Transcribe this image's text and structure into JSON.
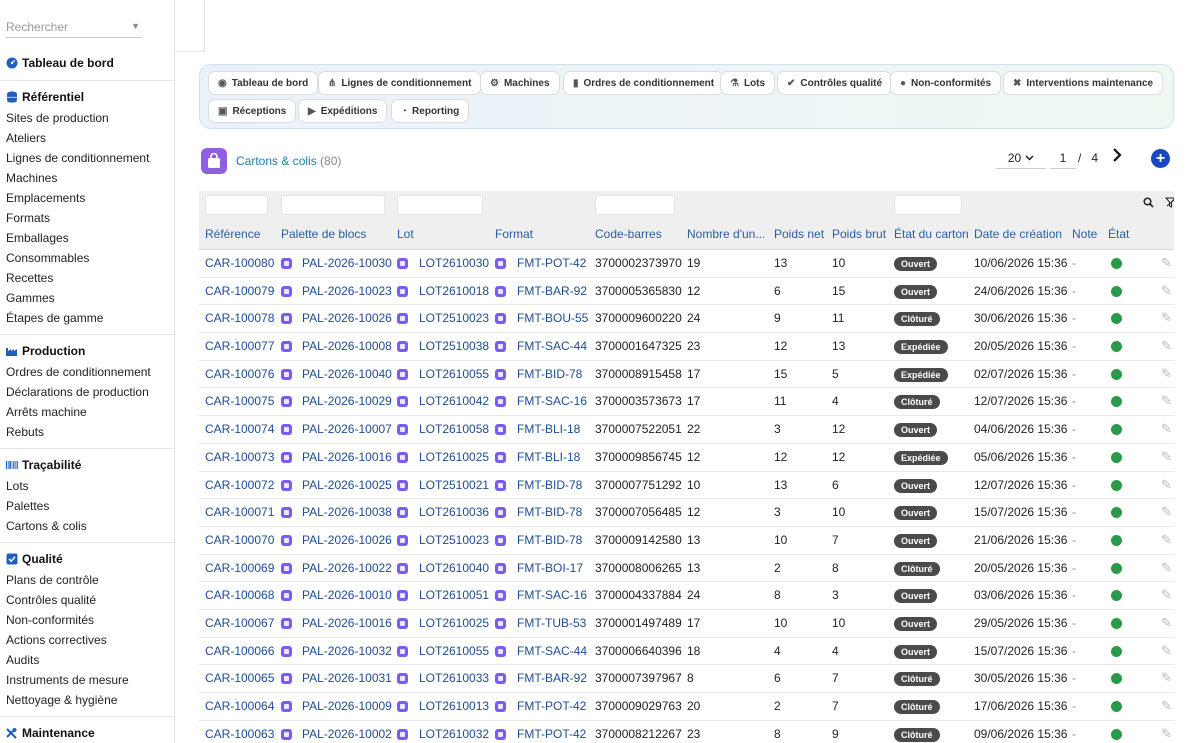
{
  "search": {
    "placeholder": "Rechercher"
  },
  "sidebar": {
    "dashboard": "Tableau de bord",
    "sections": [
      {
        "title": "Référentiel",
        "icon": "database-icon",
        "items": [
          "Sites de production",
          "Ateliers",
          "Lignes de conditionnement",
          "Machines",
          "Emplacements",
          "Formats",
          "Emballages",
          "Consommables",
          "Recettes",
          "Gammes",
          "Étapes de gamme"
        ]
      },
      {
        "title": "Production",
        "icon": "factory-icon",
        "items": [
          "Ordres de conditionnement",
          "Déclarations de production",
          "Arrêts machine",
          "Rebuts"
        ]
      },
      {
        "title": "Traçabilité",
        "icon": "barcode-icon",
        "items": [
          "Lots",
          "Palettes",
          "Cartons & colis"
        ]
      },
      {
        "title": "Qualité",
        "icon": "checkbox-icon",
        "items": [
          "Plans de contrôle",
          "Contrôles qualité",
          "Non-conformités",
          "Actions correctives",
          "Audits",
          "Instruments de mesure",
          "Nettoyage & hygiène"
        ]
      },
      {
        "title": "Maintenance",
        "icon": "wrench-icon",
        "items": []
      }
    ]
  },
  "tabs": [
    {
      "label": "Tableau de bord",
      "icon": "gauge-icon"
    },
    {
      "label": "Lignes de conditionnement",
      "icon": "network-icon"
    },
    {
      "label": "Machines",
      "icon": "gears-icon"
    },
    {
      "label": "Ordres de conditionnement",
      "icon": "clipboard-icon"
    },
    {
      "label": "Lots",
      "icon": "flask-icon"
    },
    {
      "label": "Contrôles qualité",
      "icon": "check-circle-icon"
    },
    {
      "label": "Non-conformités",
      "icon": "alert-icon"
    },
    {
      "label": "Interventions maintenance",
      "icon": "tools-icon"
    },
    {
      "label": "Réceptions",
      "icon": "truck-loading-icon"
    },
    {
      "label": "Expéditions",
      "icon": "truck-icon"
    },
    {
      "label": "Reporting",
      "icon": "pie-icon"
    }
  ],
  "page": {
    "title": "Cartons & colis",
    "count": "(80)"
  },
  "pager": {
    "size": "20",
    "page": "1",
    "separator": "/",
    "total": "4"
  },
  "table": {
    "columns": [
      "Référence",
      "Palette de blocs",
      "Lot",
      "Format",
      "Code-barres",
      "Nombre d'un...",
      "Poids net",
      "Poids brut",
      "État du carton",
      "Date de création",
      "Note",
      "État"
    ],
    "rows": [
      {
        "ref": "CAR-100080",
        "palette": "PAL-2026-10030",
        "lot": "LOT2610030",
        "format": "FMT-POT-42",
        "barcode": "3700002373970",
        "units": "19",
        "net": "13",
        "gross": "10",
        "status": "Ouvert",
        "date": "10/06/2026 15:36",
        "note": "-"
      },
      {
        "ref": "CAR-100079",
        "palette": "PAL-2026-10023",
        "lot": "LOT2610018",
        "format": "FMT-BAR-92",
        "barcode": "3700005365830",
        "units": "12",
        "net": "6",
        "gross": "15",
        "status": "Ouvert",
        "date": "24/06/2026 15:36",
        "note": "-"
      },
      {
        "ref": "CAR-100078",
        "palette": "PAL-2026-10026",
        "lot": "LOT2510023",
        "format": "FMT-BOU-55",
        "barcode": "3700009600220",
        "units": "24",
        "net": "9",
        "gross": "11",
        "status": "Clôturé",
        "date": "30/06/2026 15:36",
        "note": "-"
      },
      {
        "ref": "CAR-100077",
        "palette": "PAL-2026-10008",
        "lot": "LOT2510038",
        "format": "FMT-SAC-44",
        "barcode": "3700001647325",
        "units": "23",
        "net": "12",
        "gross": "13",
        "status": "Expédiée",
        "date": "20/05/2026 15:36",
        "note": "-"
      },
      {
        "ref": "CAR-100076",
        "palette": "PAL-2026-10040",
        "lot": "LOT2610055",
        "format": "FMT-BID-78",
        "barcode": "3700008915458",
        "units": "17",
        "net": "15",
        "gross": "5",
        "status": "Expédiée",
        "date": "02/07/2026 15:36",
        "note": "-"
      },
      {
        "ref": "CAR-100075",
        "palette": "PAL-2026-10029",
        "lot": "LOT2610042",
        "format": "FMT-SAC-16",
        "barcode": "3700003573673",
        "units": "17",
        "net": "11",
        "gross": "4",
        "status": "Clôturé",
        "date": "12/07/2026 15:36",
        "note": "-"
      },
      {
        "ref": "CAR-100074",
        "palette": "PAL-2026-10007",
        "lot": "LOT2610058",
        "format": "FMT-BLI-18",
        "barcode": "3700007522051",
        "units": "22",
        "net": "3",
        "gross": "12",
        "status": "Ouvert",
        "date": "04/06/2026 15:36",
        "note": "-"
      },
      {
        "ref": "CAR-100073",
        "palette": "PAL-2026-10016",
        "lot": "LOT2610025",
        "format": "FMT-BLI-18",
        "barcode": "3700009856745",
        "units": "12",
        "net": "12",
        "gross": "12",
        "status": "Expédiée",
        "date": "05/06/2026 15:36",
        "note": "-"
      },
      {
        "ref": "CAR-100072",
        "palette": "PAL-2026-10025",
        "lot": "LOT2510021",
        "format": "FMT-BID-78",
        "barcode": "3700007751292",
        "units": "10",
        "net": "13",
        "gross": "6",
        "status": "Ouvert",
        "date": "12/07/2026 15:36",
        "note": "-"
      },
      {
        "ref": "CAR-100071",
        "palette": "PAL-2026-10038",
        "lot": "LOT2610036",
        "format": "FMT-BID-78",
        "barcode": "3700007056485",
        "units": "12",
        "net": "3",
        "gross": "10",
        "status": "Ouvert",
        "date": "15/07/2026 15:36",
        "note": "-"
      },
      {
        "ref": "CAR-100070",
        "palette": "PAL-2026-10026",
        "lot": "LOT2510023",
        "format": "FMT-BID-78",
        "barcode": "3700009142580",
        "units": "13",
        "net": "10",
        "gross": "7",
        "status": "Ouvert",
        "date": "21/06/2026 15:36",
        "note": "-"
      },
      {
        "ref": "CAR-100069",
        "palette": "PAL-2026-10022",
        "lot": "LOT2610040",
        "format": "FMT-BOI-17",
        "barcode": "3700008006265",
        "units": "13",
        "net": "2",
        "gross": "8",
        "status": "Clôturé",
        "date": "20/05/2026 15:36",
        "note": "-"
      },
      {
        "ref": "CAR-100068",
        "palette": "PAL-2026-10010",
        "lot": "LOT2610051",
        "format": "FMT-SAC-16",
        "barcode": "3700004337884",
        "units": "24",
        "net": "8",
        "gross": "3",
        "status": "Ouvert",
        "date": "03/06/2026 15:36",
        "note": "-"
      },
      {
        "ref": "CAR-100067",
        "palette": "PAL-2026-10016",
        "lot": "LOT2610025",
        "format": "FMT-TUB-53",
        "barcode": "3700001497489",
        "units": "17",
        "net": "10",
        "gross": "10",
        "status": "Ouvert",
        "date": "29/05/2026 15:36",
        "note": "-"
      },
      {
        "ref": "CAR-100066",
        "palette": "PAL-2026-10032",
        "lot": "LOT2610055",
        "format": "FMT-SAC-44",
        "barcode": "3700006640396",
        "units": "18",
        "net": "4",
        "gross": "4",
        "status": "Ouvert",
        "date": "15/07/2026 15:36",
        "note": "-"
      },
      {
        "ref": "CAR-100065",
        "palette": "PAL-2026-10031",
        "lot": "LOT2610033",
        "format": "FMT-BAR-92",
        "barcode": "3700007397967",
        "units": "8",
        "net": "6",
        "gross": "7",
        "status": "Clôturé",
        "date": "30/05/2026 15:36",
        "note": "-"
      },
      {
        "ref": "CAR-100064",
        "palette": "PAL-2026-10009",
        "lot": "LOT2610013",
        "format": "FMT-POT-42",
        "barcode": "3700009029763",
        "units": "20",
        "net": "2",
        "gross": "7",
        "status": "Clôturé",
        "date": "17/06/2026 15:36",
        "note": "-"
      },
      {
        "ref": "CAR-100063",
        "palette": "PAL-2026-10002",
        "lot": "LOT2610032",
        "format": "FMT-POT-42",
        "barcode": "3700008212267",
        "units": "23",
        "net": "8",
        "gross": "9",
        "status": "Clôturé",
        "date": "09/06/2026 15:36",
        "note": "-"
      }
    ]
  },
  "colors": {
    "accent": "#1f7aa6",
    "page_icon": "#8f5fe0",
    "add_button": "#1947c4",
    "state_ok": "#2a9a4a",
    "badge": "#4a4a4a"
  }
}
